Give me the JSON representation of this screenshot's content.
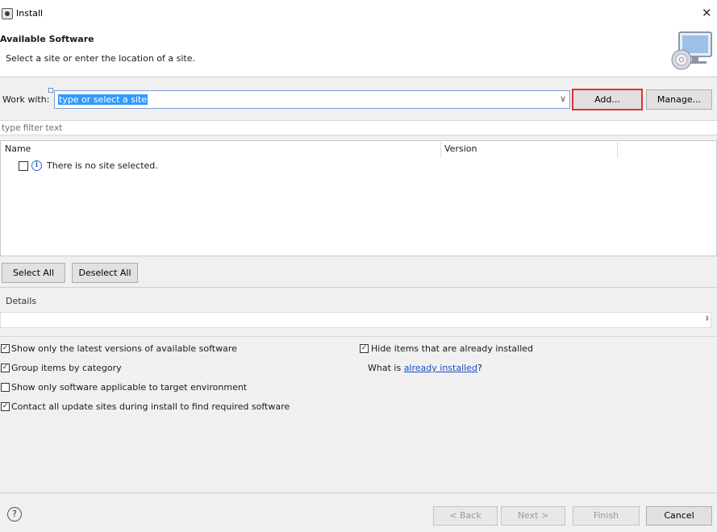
{
  "window": {
    "title": "Install"
  },
  "header": {
    "title": "Available Software",
    "description": "Select a site or enter the location of a site."
  },
  "work_with": {
    "label": "Work with:",
    "value": "type or select a site",
    "add_label": "Add...",
    "manage_label": "Manage..."
  },
  "filter": {
    "placeholder": "type filter text"
  },
  "table": {
    "columns": [
      "Name",
      "Version"
    ],
    "rows": [
      {
        "name": "There is no site selected."
      }
    ]
  },
  "selection": {
    "select_all": "Select All",
    "deselect_all": "Deselect All"
  },
  "details": {
    "label": "Details"
  },
  "options": {
    "latest_versions": {
      "label": "Show only the latest versions of available software",
      "checked": true
    },
    "group_by_category": {
      "label": "Group items by category",
      "checked": true
    },
    "target_env": {
      "label": "Show only software applicable to target environment",
      "checked": false
    },
    "contact_sites": {
      "label": "Contact all update sites during install to find required software",
      "checked": true
    },
    "hide_installed": {
      "label": "Hide items that are already installed",
      "checked": true
    },
    "what_is_prefix": "What is",
    "already_installed_link": "already installed",
    "what_is_suffix": "?"
  },
  "buttons": {
    "back": "< Back",
    "next": "Next >",
    "finish": "Finish",
    "cancel": "Cancel"
  },
  "colors": {
    "highlight": "#e03030",
    "selection": "#3399ff",
    "link": "#1a4fc4"
  }
}
